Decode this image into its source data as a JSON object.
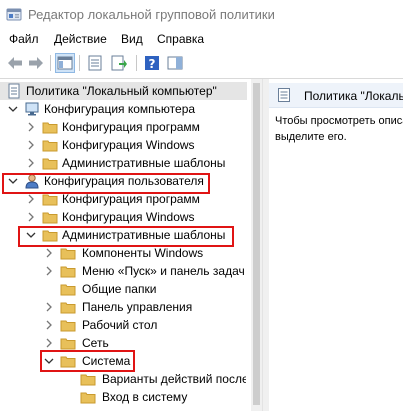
{
  "window": {
    "title": "Редактор локальной групповой политики"
  },
  "menu": [
    "Файл",
    "Действие",
    "Вид",
    "Справка"
  ],
  "toolbar": {
    "icons": [
      "back-arrow-icon",
      "forward-arrow-icon",
      "console-tree-icon",
      "properties-icon",
      "export-list-icon",
      "help-icon",
      "show-hide-pane-icon"
    ]
  },
  "tree": {
    "root": "Политика \"Локальный компьютер\"",
    "computer_config": {
      "label": "Конфигурация компьютера",
      "children": [
        "Конфигурация программ",
        "Конфигурация Windows",
        "Административные шаблоны"
      ]
    },
    "user_config": {
      "label": "Конфигурация пользователя",
      "children": [
        "Конфигурация программ",
        "Конфигурация Windows"
      ],
      "admin_templates": {
        "label": "Административные шаблоны",
        "children": [
          "Компоненты Windows",
          "Меню «Пуск» и панель задач",
          "Общие папки",
          "Панель управления",
          "Рабочий стол",
          "Сеть"
        ],
        "system": {
          "label": "Система",
          "children": [
            "Варианты действий после",
            "Вход в систему"
          ]
        }
      }
    }
  },
  "right_pane": {
    "header": "Политика \"Локальный",
    "line1": "Чтобы просмотреть описа",
    "line2": "выделите его."
  },
  "colors": {
    "highlight_box": "#e01414",
    "folder": "#e8c05a",
    "selection": "#e5e5e5",
    "header_bg": "#eef3fa"
  }
}
